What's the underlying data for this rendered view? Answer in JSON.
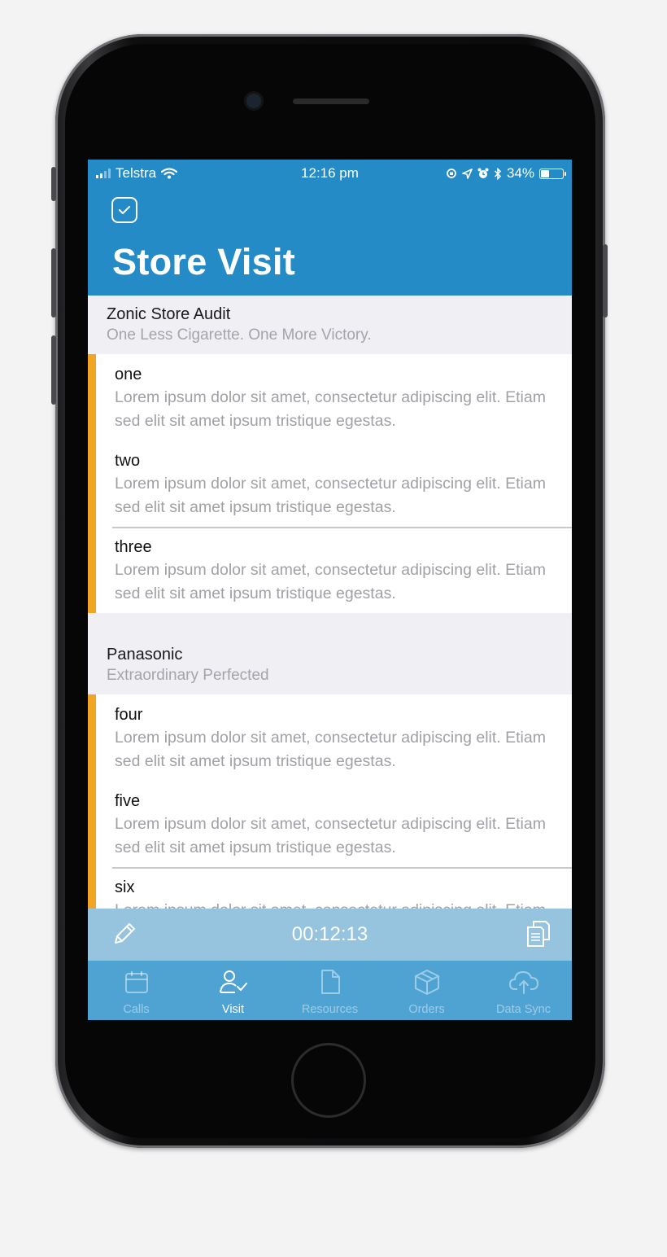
{
  "status_bar": {
    "carrier": "Telstra",
    "time": "12:16 pm",
    "battery": "34%",
    "battery_level": 0.34
  },
  "header": {
    "title": "Store Visit",
    "check_icon": "checkbox-icon"
  },
  "sections": [
    {
      "title": "Zonic Store Audit",
      "subtitle": "One Less Cigarette. One More Victory.",
      "items": [
        {
          "title": "one",
          "body": "Lorem ipsum dolor sit amet, consectetur adipiscing elit. Etiam sed elit sit amet ipsum tristique egestas."
        },
        {
          "title": "two",
          "body": "Lorem ipsum dolor sit amet, consectetur adipiscing elit. Etiam sed elit sit amet ipsum tristique egestas."
        },
        {
          "title": "three",
          "body": "Lorem ipsum dolor sit amet, consectetur adipiscing elit. Etiam sed elit sit amet ipsum tristique egestas."
        }
      ]
    },
    {
      "title": "Panasonic",
      "subtitle": "Extraordinary Perfected",
      "items": [
        {
          "title": "four",
          "body": "Lorem ipsum dolor sit amet, consectetur adipiscing elit. Etiam sed elit sit amet ipsum tristique egestas."
        },
        {
          "title": "five",
          "body": "Lorem ipsum dolor sit amet, consectetur adipiscing elit. Etiam sed elit sit amet ipsum tristique egestas."
        },
        {
          "title": "six",
          "body": "Lorem ipsum dolor sit amet, consectetur adipiscing elit. Etiam sed elit sit amet ipsum tristique egestas."
        }
      ]
    }
  ],
  "timer_bar": {
    "timer": "00:12:13",
    "left_icon": "pencil-icon",
    "right_icon": "documents-icon"
  },
  "tabs": [
    {
      "label": "Calls",
      "icon": "calendar-icon",
      "active": false
    },
    {
      "label": "Visit",
      "icon": "person-check-icon",
      "active": true
    },
    {
      "label": "Resources",
      "icon": "document-icon",
      "active": false
    },
    {
      "label": "Orders",
      "icon": "box-icon",
      "active": false
    },
    {
      "label": "Data Sync",
      "icon": "cloud-upload-icon",
      "active": false
    }
  ],
  "colors": {
    "header": "#258bc6",
    "accent_bar": "#f0a623",
    "timer_bar": "#96c4de",
    "tab_bar": "#4ea3d3",
    "section_bg": "#efeff4"
  }
}
